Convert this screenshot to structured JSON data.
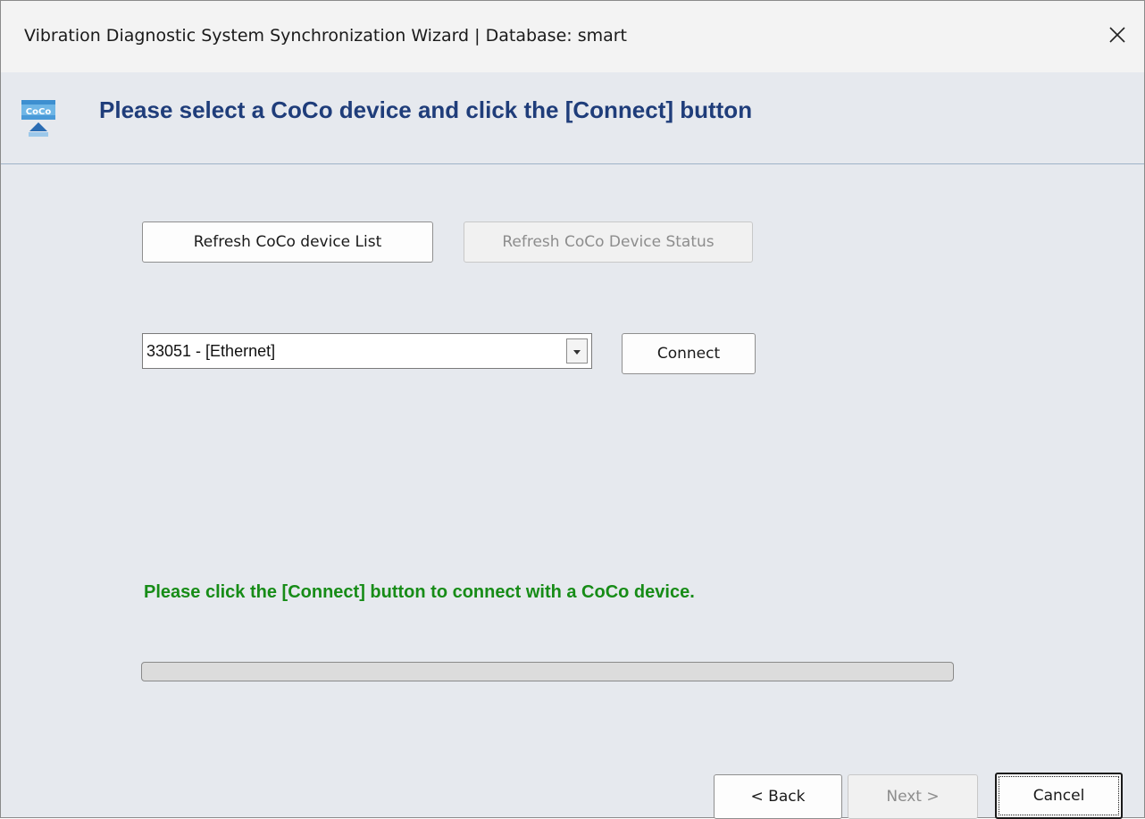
{
  "window": {
    "title": "Vibration Diagnostic System Synchronization Wizard | Database: smart",
    "close_icon": "close-icon"
  },
  "header": {
    "icon": "coco-device-icon",
    "icon_label": "CoCo",
    "title": "Please select a CoCo device and click the [Connect] button"
  },
  "buttons": {
    "refresh_list": "Refresh CoCo device List",
    "refresh_status": "Refresh CoCo Device Status",
    "connect": "Connect",
    "back": "< Back",
    "next": "Next >",
    "cancel": "Cancel"
  },
  "device_select": {
    "selected": "33051 - [Ethernet]"
  },
  "status": {
    "message": "Please click the [Connect] button to connect with a CoCo device.",
    "progress_percent": 0
  },
  "colors": {
    "header_title": "#1f3d7a",
    "status_message": "#178c17",
    "window_background": "#e6e9ee"
  }
}
